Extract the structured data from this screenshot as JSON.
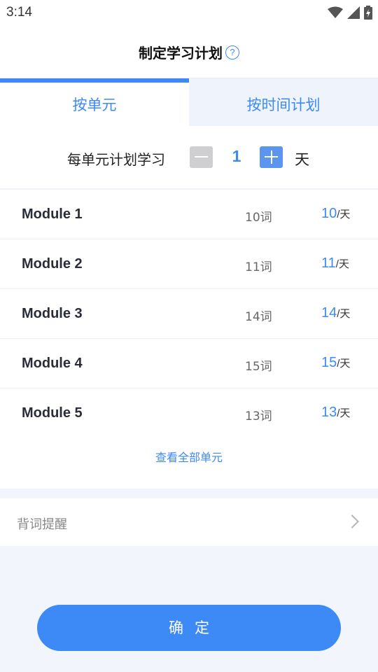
{
  "status_bar": {
    "time": "3:14"
  },
  "header": {
    "title": "制定学习计划",
    "help_icon_label": "?"
  },
  "tabs": [
    {
      "label": "按单元",
      "active": true
    },
    {
      "label": "按时间计划",
      "active": false
    }
  ],
  "per_unit": {
    "label": "每单元计划学习",
    "value": "1",
    "unit": "天"
  },
  "modules": [
    {
      "name": "Module 1",
      "words": "10词",
      "rate": "10",
      "per_day": "/天"
    },
    {
      "name": "Module 2",
      "words": "11词",
      "rate": "11",
      "per_day": "/天"
    },
    {
      "name": "Module 3",
      "words": "14词",
      "rate": "14",
      "per_day": "/天"
    },
    {
      "name": "Module 4",
      "words": "15词",
      "rate": "15",
      "per_day": "/天"
    },
    {
      "name": "Module 5",
      "words": "13词",
      "rate": "13",
      "per_day": "/天"
    }
  ],
  "view_all_label": "查看全部单元",
  "reminder": {
    "label": "背词提醒"
  },
  "confirm_label": "确定",
  "colors": {
    "accent": "#3d8af7",
    "background": "#f2f5fc"
  },
  "icons": [
    "wifi-icon",
    "signal-icon",
    "battery-icon",
    "help-icon",
    "minus-icon",
    "plus-icon",
    "chevron-right-icon"
  ]
}
